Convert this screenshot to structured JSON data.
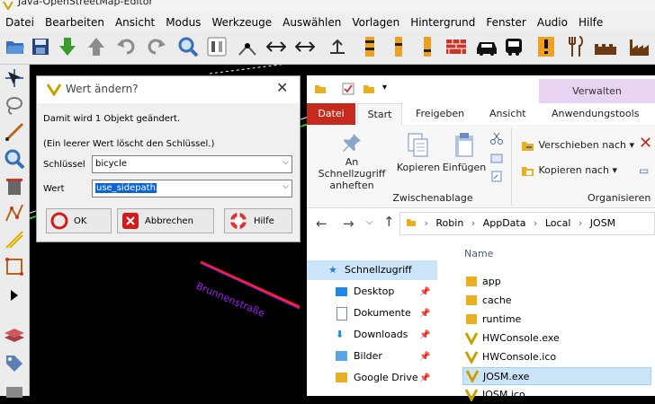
{
  "window": {
    "title": "Java-OpenStreetMap-Editor"
  },
  "menubar": [
    "Datei",
    "Bearbeiten",
    "Ansicht",
    "Modus",
    "Werkzeuge",
    "Auswählen",
    "Vorlagen",
    "Hintergrund",
    "Fenster",
    "Audio",
    "Hilfe"
  ],
  "map": {
    "street_label": "Brunnenstraße"
  },
  "dialog": {
    "title": "Wert ändern?",
    "info": "Damit wird 1 Objekt geändert.",
    "hint": "(Ein leerer Wert löscht den Schlüssel.)",
    "key_label": "Schlüssel",
    "key_value": "bicycle",
    "value_label": "Wert",
    "value_value": "use_sidepath",
    "ok": "OK",
    "cancel": "Abbrechen",
    "help": "Hilfe"
  },
  "explorer": {
    "manage_tab": "Verwalten",
    "tabs": [
      "Datei",
      "Start",
      "Freigeben",
      "Ansicht",
      "Anwendungstools"
    ],
    "ribbon": {
      "pin": "An Schnellzugriff anheften",
      "copy": "Kopieren",
      "paste": "Einfügen",
      "group_clipboard": "Zwischenablage",
      "move": "Verschieben nach",
      "copy_to": "Kopieren nach",
      "group_organize": "Organisieren"
    },
    "breadcrumb": [
      "Robin",
      "AppData",
      "Local",
      "JOSM"
    ],
    "column_name": "Name",
    "nav": [
      {
        "label": "Schnellzugriff",
        "pinned": false
      },
      {
        "label": "Desktop",
        "pinned": true
      },
      {
        "label": "Dokumente",
        "pinned": true
      },
      {
        "label": "Downloads",
        "pinned": true
      },
      {
        "label": "Bilder",
        "pinned": true
      },
      {
        "label": "Google Drive",
        "pinned": true
      }
    ],
    "files": [
      "app",
      "cache",
      "runtime",
      "HWConsole.exe",
      "HWConsole.ico",
      "JOSM.exe",
      "JOSM.ico"
    ],
    "selected_file": "JOSM.exe"
  }
}
